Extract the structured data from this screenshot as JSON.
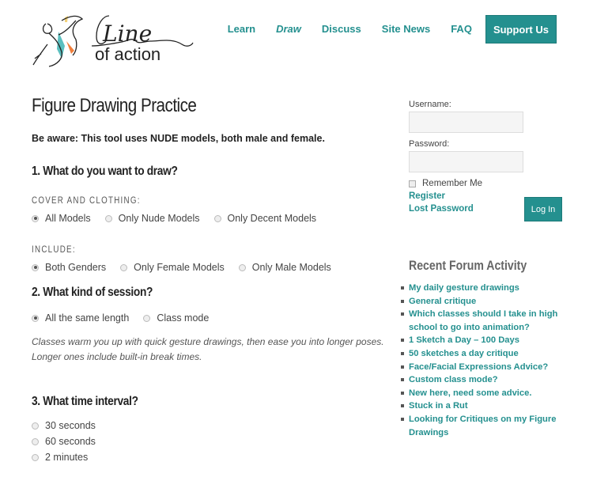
{
  "logo": {
    "line1": "Line",
    "line2": "of action",
    "colors": {
      "teal": "#5bbfbf",
      "orange": "#f07f3c",
      "yellow": "#f3d27a"
    }
  },
  "nav": {
    "items": [
      {
        "label": "Learn"
      },
      {
        "label": "Draw",
        "current": true
      },
      {
        "label": "Discuss"
      },
      {
        "label": "Site News"
      },
      {
        "label": "FAQ"
      }
    ],
    "support_label": "Support Us"
  },
  "main": {
    "title": "Figure Drawing Practice",
    "warning": "Be aware: This tool uses NUDE models, both male and female.",
    "q1": {
      "question": "1. What do you want to draw?",
      "cover": {
        "label": "COVER AND CLOTHING:",
        "options": [
          "All Models",
          "Only Nude Models",
          "Only Decent Models"
        ],
        "selected": "All Models"
      },
      "include": {
        "label": "INCLUDE:",
        "options": [
          "Both Genders",
          "Only Female Models",
          "Only Male Models"
        ],
        "selected": "Both Genders"
      }
    },
    "q2": {
      "question": "2. What kind of session?",
      "options": [
        "All the same length",
        "Class mode"
      ],
      "selected": "All the same length",
      "note": "Classes warm you up with quick gesture drawings, then ease you into longer poses. Longer ones include built-in break times."
    },
    "q3": {
      "question": "3. What time interval?",
      "options": [
        "30 seconds",
        "60 seconds",
        "2 minutes"
      ]
    }
  },
  "sidebar": {
    "username_label": "Username:",
    "username_value": "",
    "password_label": "Password:",
    "password_value": "",
    "remember_label": "Remember Me",
    "register_label": "Register",
    "lost_password_label": "Lost Password",
    "login_label": "Log In",
    "forum_title": "Recent Forum Activity",
    "forum_items": [
      "My daily gesture drawings",
      "General critique",
      "Which classes should I take in high school to go into animation?",
      "1 Sketch a Day – 100 Days",
      "50 sketches a day critique",
      "Face/Facial Expressions Advice?",
      "Custom class mode?",
      "New here, need some advice.",
      "Stuck in a Rut",
      "Looking for Critiques on my Figure Drawings"
    ]
  },
  "colors": {
    "accent": "#24908f"
  }
}
